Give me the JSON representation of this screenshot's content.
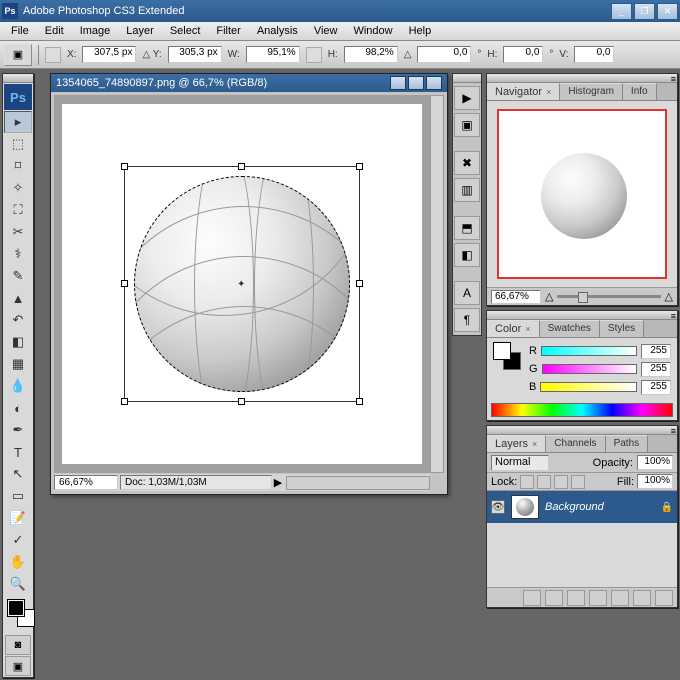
{
  "title": "Adobe Photoshop CS3 Extended",
  "menu": [
    "File",
    "Edit",
    "Image",
    "Layer",
    "Select",
    "Filter",
    "Analysis",
    "View",
    "Window",
    "Help"
  ],
  "options": {
    "x": "307,5 px",
    "y": "305,3 px",
    "w": "95,1%",
    "h": "98,2%",
    "a": "0,0",
    "hs": "0,0",
    "vs": "0,0"
  },
  "doc": {
    "title": "1354065_74890897.png @ 66,7% (RGB/8)",
    "zoom": "66,67%",
    "info": "Doc: 1,03M/1,03M"
  },
  "nav": {
    "tabs": [
      "Navigator",
      "Histogram",
      "Info"
    ],
    "zoom": "66,67%"
  },
  "color": {
    "tabs": [
      "Color",
      "Swatches",
      "Styles"
    ],
    "r": "255",
    "g": "255",
    "b": "255"
  },
  "layers": {
    "tabs": [
      "Layers",
      "Channels",
      "Paths"
    ],
    "blend": "Normal",
    "opacityLabel": "Opacity:",
    "opacity": "100%",
    "lockLabel": "Lock:",
    "fillLabel": "Fill:",
    "fill": "100%",
    "layerName": "Background"
  }
}
